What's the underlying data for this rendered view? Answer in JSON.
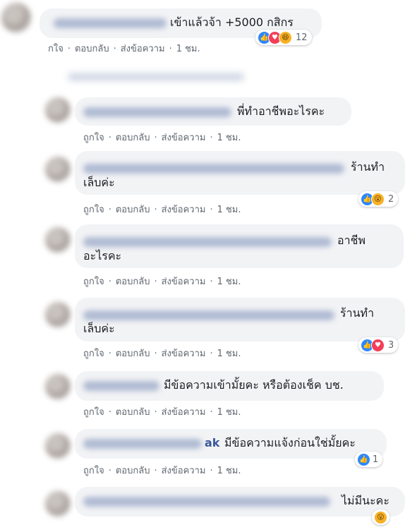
{
  "actions": {
    "like": "ถูกใจ",
    "like_cut": "กใจ",
    "reply": "ตอบกลับ",
    "message": "ส่งข้อความ",
    "time": "1 ชม."
  },
  "comments": [
    {
      "text": "เข้าแล้วจ้า +5000 กสิกร",
      "reaction_count": "12"
    },
    {
      "text": "พี่ทำอาชีพอะไรคะ"
    },
    {
      "text_line1": "ร้านทำ",
      "text_line2": "เล็บค่ะ",
      "reaction_count": "2"
    },
    {
      "text_line1": "อาชีพ",
      "text_line2": "อะไรคะ"
    },
    {
      "text_line1": "ร้านทำ",
      "text_line2": "เล็บค่ะ",
      "reaction_count": "3"
    },
    {
      "text": "มีข้อความเข้ามั้ยคะ หรือต้องเช็ค บช."
    },
    {
      "name_suffix": "ak",
      "text": "มีข้อความแจ้งก่อนใช่มั้ยคะ",
      "reaction_count": "1"
    },
    {
      "text": "ไม่มีนะคะ"
    }
  ],
  "icons": [
    "like-icon",
    "love-icon",
    "haha-icon",
    "wow-icon"
  ]
}
